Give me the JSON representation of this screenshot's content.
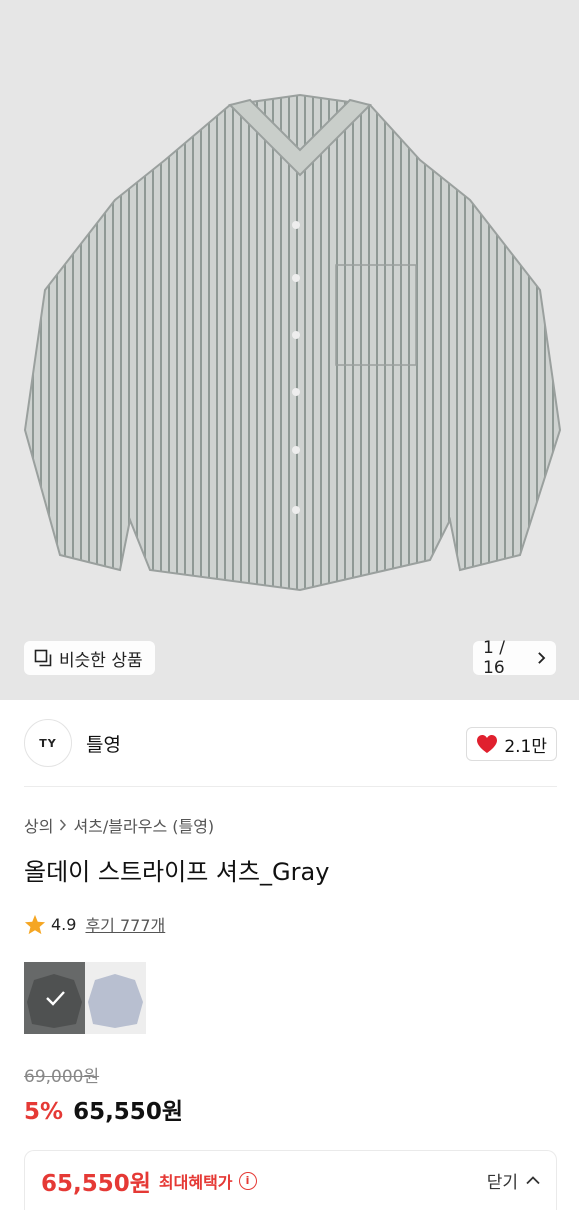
{
  "hero": {
    "similar_label": "비슷한 상품",
    "pager_label": "1 / 16"
  },
  "brand": {
    "logo_text": "TY",
    "name": "틀영",
    "likes": "2.1만"
  },
  "breadcrumb": {
    "category": "상의",
    "subcategory": "셔츠/블라우스 (틀영)"
  },
  "product": {
    "title": "올데이 스트라이프 셔츠_Gray",
    "rating": "4.9",
    "reviews": "후기 777개"
  },
  "pricing": {
    "original": "69,000원",
    "discount": "5%",
    "price": "65,550원"
  },
  "bottom_bar": {
    "price": "65,550원",
    "label": "최대혜택가",
    "close_label": "닫기"
  },
  "colors": {
    "accent": "#e53935",
    "heart": "#e0202e",
    "star": "#f5a623"
  },
  "icons": [
    "copy-icon",
    "chevron-right-icon",
    "heart-icon",
    "star-icon",
    "check-icon",
    "info-icon",
    "chevron-up-icon"
  ]
}
